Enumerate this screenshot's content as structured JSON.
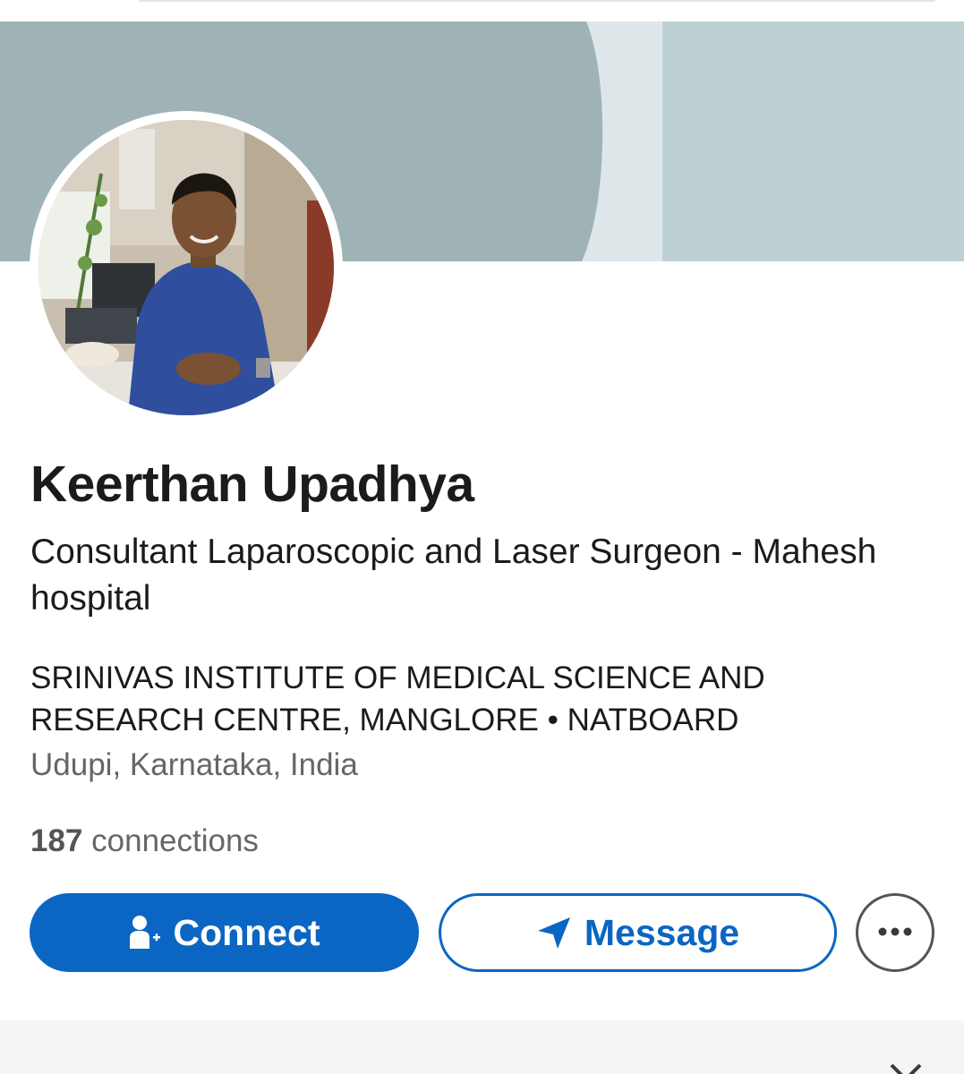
{
  "profile": {
    "name": "Keerthan Upadhya",
    "headline": "Consultant Laparoscopic and Laser Surgeon - Mahesh hospital",
    "education": "SRINIVAS INSTITUTE OF MEDICAL SCIENCE AND RESEARCH CENTRE, MANGLORE • NATBOARD",
    "location": "Udupi, Karnataka, India",
    "connections_count": "187",
    "connections_label": "connections"
  },
  "actions": {
    "connect_label": "Connect",
    "message_label": "Message",
    "more_icon": "ellipsis-icon"
  },
  "colors": {
    "primary": "#0a66c2",
    "banner_dark": "#9fb3b6",
    "banner_light": "#bdd1d4",
    "banner_pale": "#dde7e9"
  }
}
